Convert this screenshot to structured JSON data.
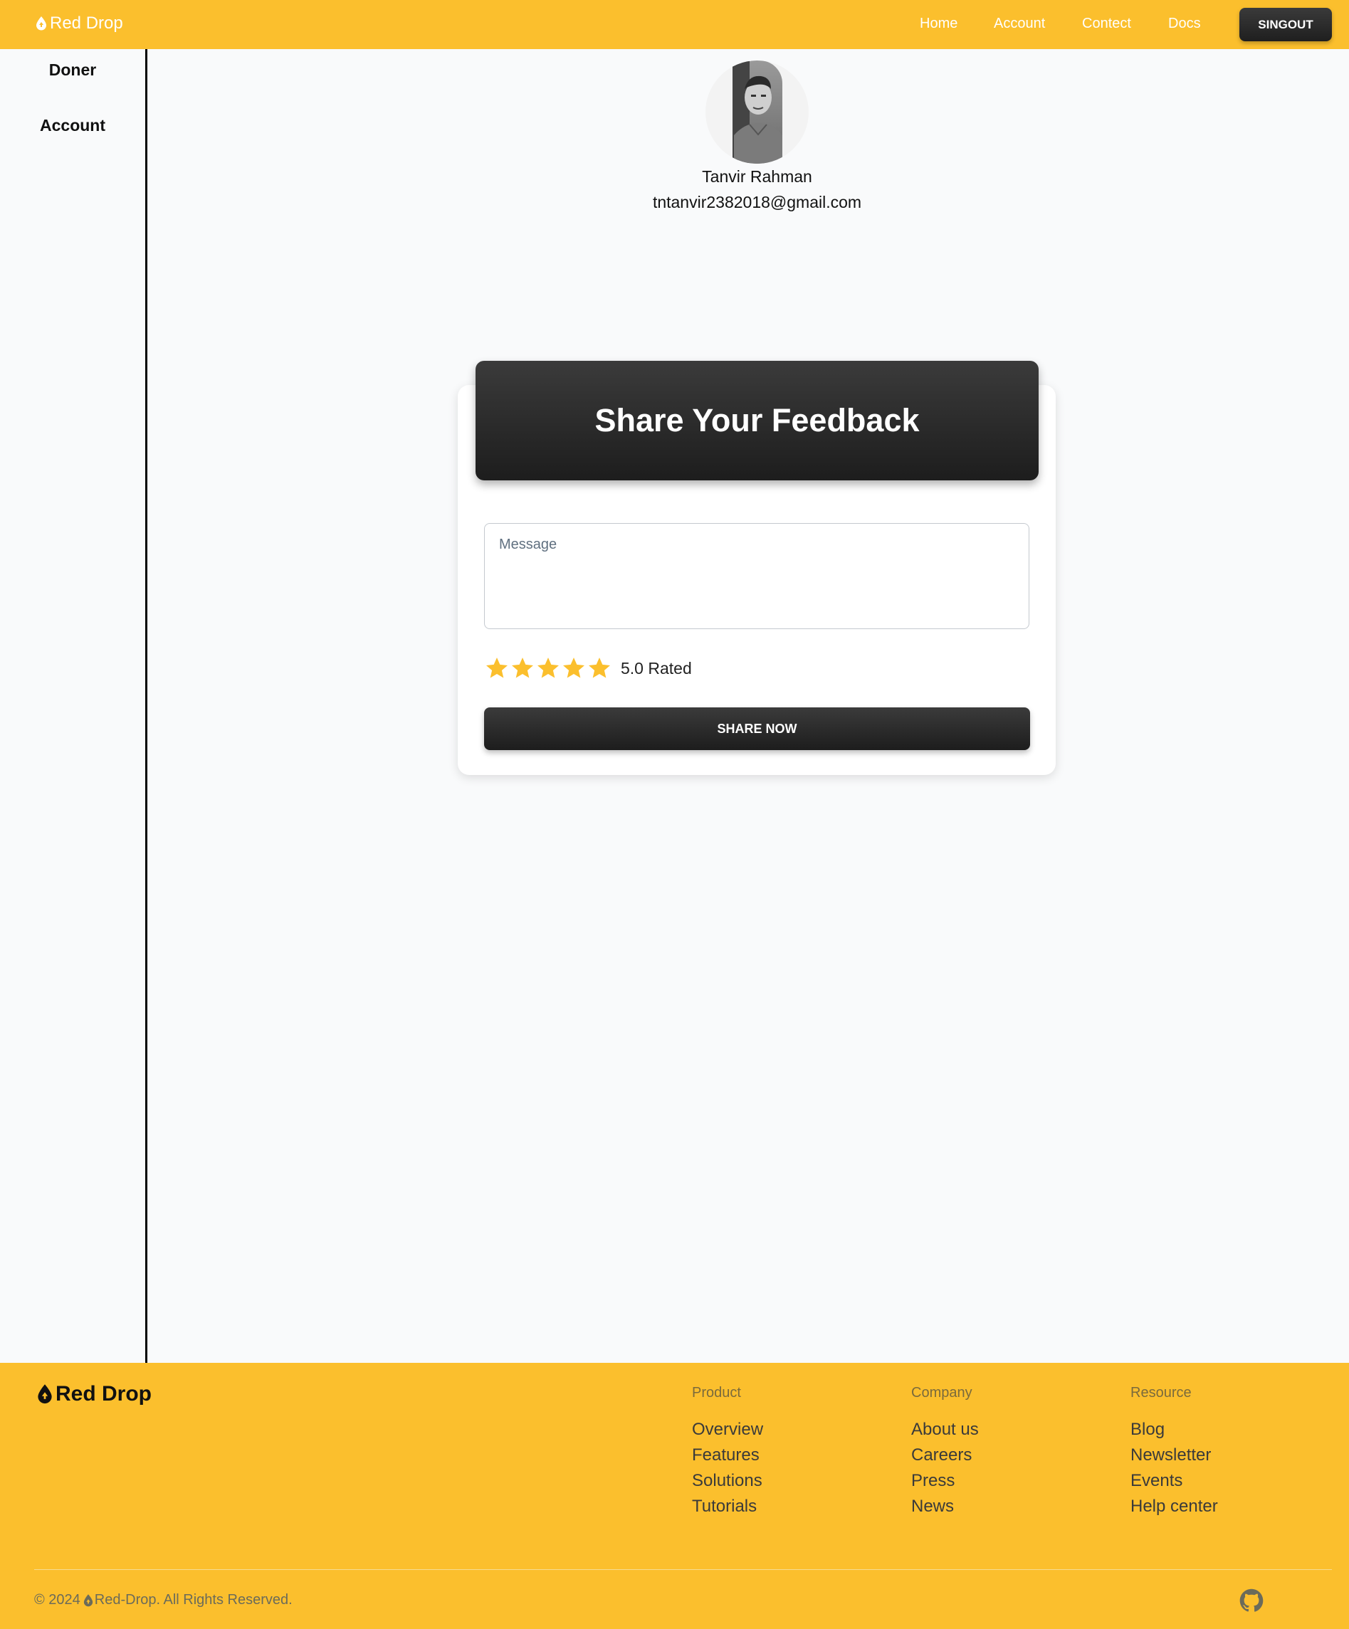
{
  "header": {
    "brand": "Red Drop",
    "nav": [
      "Home",
      "Account",
      "Contect",
      "Docs"
    ],
    "signout_label": "SINGOUT"
  },
  "sidebar": {
    "items": [
      "Doner",
      "Account"
    ]
  },
  "profile": {
    "name": "Tanvir Rahman",
    "email": "tntanvir2382018@gmail.com"
  },
  "feedback": {
    "title": "Share Your Feedback",
    "message_placeholder": "Message",
    "rating": 5,
    "rating_text": "5.0 Rated",
    "submit_label": "SHARE NOW"
  },
  "footer": {
    "brand": "Red Drop",
    "columns": [
      {
        "title": "Product",
        "links": [
          "Overview",
          "Features",
          "Solutions",
          "Tutorials"
        ]
      },
      {
        "title": "Company",
        "links": [
          "About us",
          "Careers",
          "Press",
          "News"
        ]
      },
      {
        "title": "Resource",
        "links": [
          "Blog",
          "Newsletter",
          "Events",
          "Help center"
        ]
      }
    ],
    "copyright_prefix": "© 2024",
    "copyright_suffix": "Red-Drop. All Rights Reserved."
  },
  "colors": {
    "brand_yellow": "#fbbf2d",
    "dark_button": "#2a2a2a",
    "star": "#fbbf2d"
  }
}
